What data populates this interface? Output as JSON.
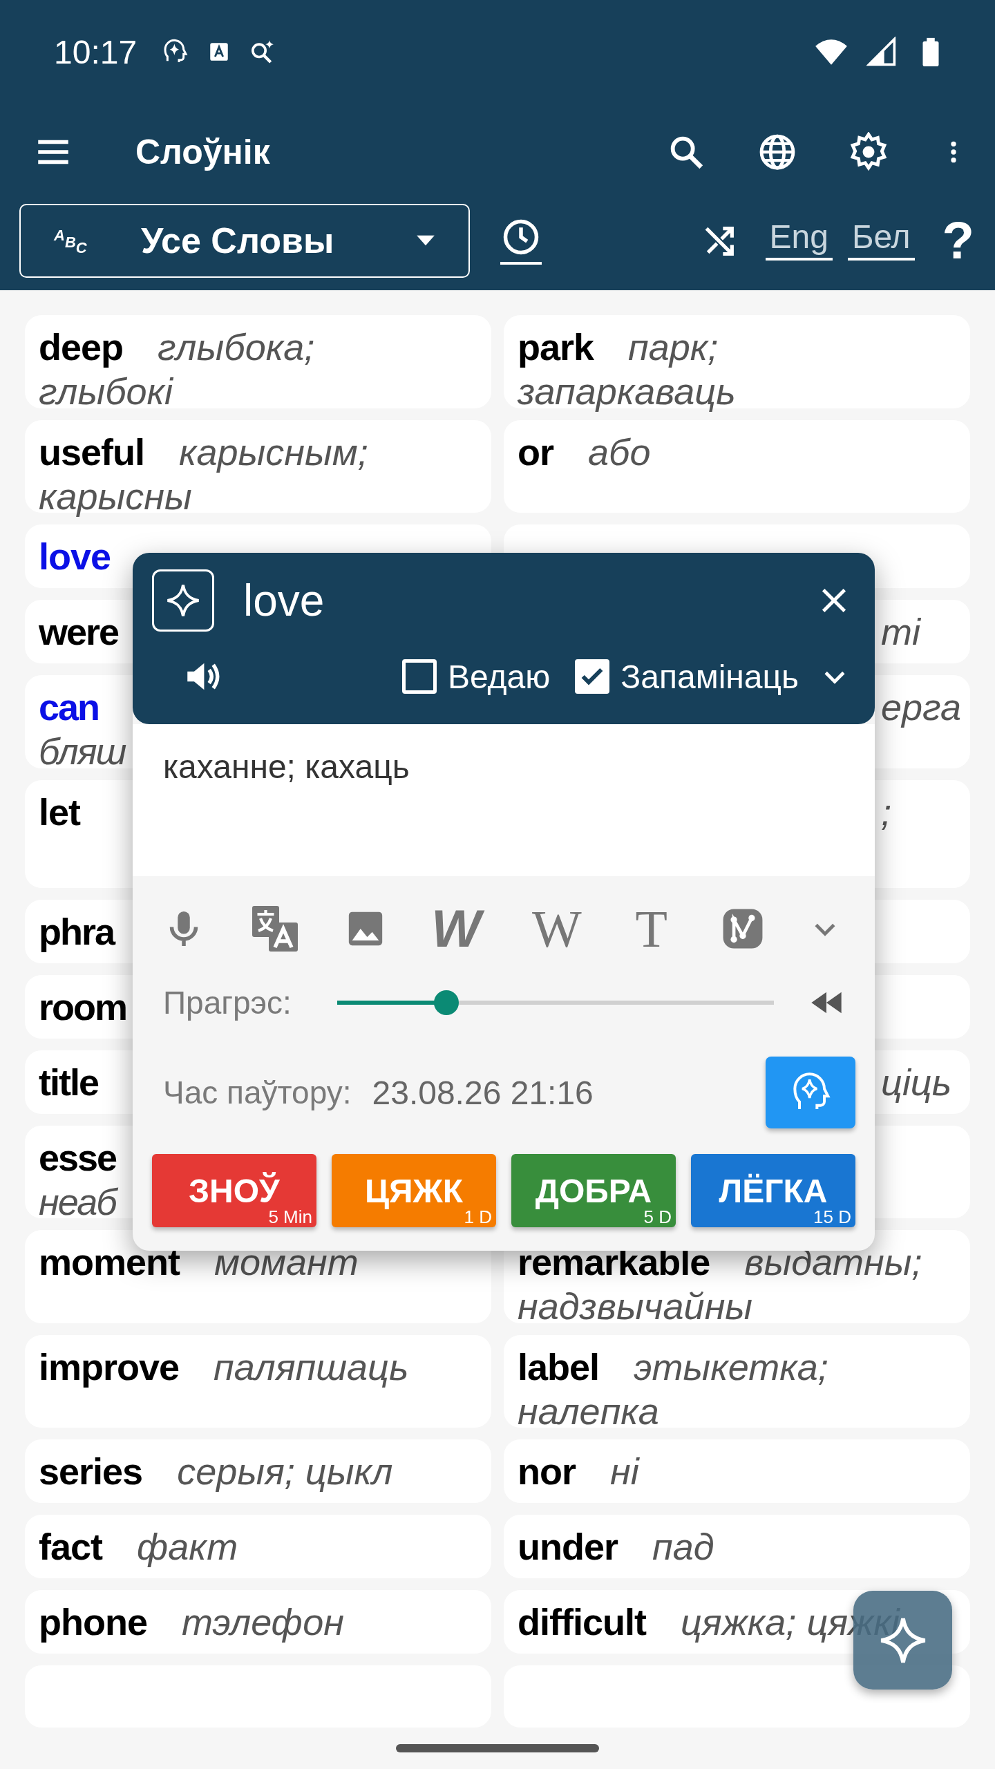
{
  "status_bar": {
    "time": "10:17"
  },
  "app_bar": {
    "title": "Слоўнік"
  },
  "filter": {
    "list_icon": "ABC",
    "selection": "Усе Словы",
    "languages": [
      {
        "label": "Eng"
      },
      {
        "label": "Бел"
      }
    ],
    "help": "?"
  },
  "cards": [
    {
      "kind": "entry",
      "word": "deep",
      "translation": "глыбока; глыбокі",
      "highlighted": false
    },
    {
      "kind": "entry",
      "word": "park",
      "translation": "парк; запаркаваць",
      "highlighted": false
    },
    {
      "kind": "entry",
      "word": "useful",
      "translation": "карысным; карысны",
      "highlighted": false
    },
    {
      "kind": "entry",
      "word": "or",
      "translation": "або",
      "highlighted": false
    },
    {
      "kind": "entry",
      "word": "love",
      "highlighted": true
    },
    {
      "kind": "blank"
    },
    {
      "kind": "cut_left",
      "word": "were",
      "highlighted": false
    },
    {
      "kind": "cut_right",
      "translation": "ті"
    },
    {
      "kind": "cut_left",
      "word": "can",
      "translation": "бляш",
      "highlighted": true
    },
    {
      "kind": "cut_right",
      "translation": "ерга"
    },
    {
      "kind": "entry",
      "word": "let",
      "highlighted": false
    },
    {
      "kind": "cut_right_tall",
      "translation": ";"
    },
    {
      "kind": "cut_left",
      "word": "phra",
      "highlighted": false
    },
    {
      "kind": "blank"
    },
    {
      "kind": "cut_left",
      "word": "room",
      "highlighted": false
    },
    {
      "kind": "blank"
    },
    {
      "kind": "cut_left",
      "word": "title",
      "highlighted": false
    },
    {
      "kind": "cut_right",
      "translation": "ціць"
    },
    {
      "kind": "cut_left",
      "word": "esse",
      "translation": "неаб",
      "highlighted": false
    },
    {
      "kind": "blank"
    },
    {
      "kind": "entry",
      "word": "moment",
      "translation": "момант",
      "highlighted": false
    },
    {
      "kind": "entry",
      "word": "remarkable",
      "translation": "выдатны; надзвычайны",
      "highlighted": false
    },
    {
      "kind": "entry",
      "word": "improve",
      "translation": "паляпшаць",
      "highlighted": false
    },
    {
      "kind": "entry",
      "word": "label",
      "translation": "этыкетка; налепка",
      "highlighted": false
    },
    {
      "kind": "entry",
      "word": "series",
      "translation": "серыя; цыкл",
      "highlighted": false
    },
    {
      "kind": "entry",
      "word": "nor",
      "translation": "ні",
      "highlighted": false
    },
    {
      "kind": "entry",
      "word": "fact",
      "translation": "факт",
      "highlighted": false
    },
    {
      "kind": "entry",
      "word": "under",
      "translation": "пад",
      "highlighted": false
    },
    {
      "kind": "entry",
      "word": "phone",
      "translation": "тэлефон",
      "highlighted": false
    },
    {
      "kind": "entry",
      "word": "difficult",
      "translation": "цяжка; цяжкі",
      "highlighted": false
    },
    {
      "kind": "blank"
    },
    {
      "kind": "blank"
    }
  ],
  "popup": {
    "word": "love",
    "options": [
      {
        "label": "Ведаю",
        "checked": false
      },
      {
        "label": "Запамінаць",
        "checked": true
      }
    ],
    "translation": "каханне; кахаць",
    "tools": [
      {
        "kind": "mic"
      },
      {
        "kind": "translate"
      },
      {
        "kind": "image"
      },
      {
        "kind": "glyph_italic",
        "glyph": "W"
      },
      {
        "kind": "glyph_serif",
        "glyph": "W"
      },
      {
        "kind": "glyph_serif",
        "glyph": "T"
      },
      {
        "kind": "graph"
      },
      {
        "kind": "chevron"
      }
    ],
    "progress": {
      "label": "Прагрэс:",
      "level": 0.25
    },
    "review": {
      "label": "Час паўтору:",
      "value": "23.08.26 21:16"
    },
    "grades": [
      {
        "label": "ЗНОЎ",
        "interval": "5 Min",
        "color": "#e53935"
      },
      {
        "label": "ЦЯЖК",
        "interval": "1 D",
        "color": "#f57c00"
      },
      {
        "label": "ДОБРА",
        "interval": "5 D",
        "color": "#388e3c"
      },
      {
        "label": "ЛЁГКА",
        "interval": "15 D",
        "color": "#1976d2"
      }
    ]
  }
}
